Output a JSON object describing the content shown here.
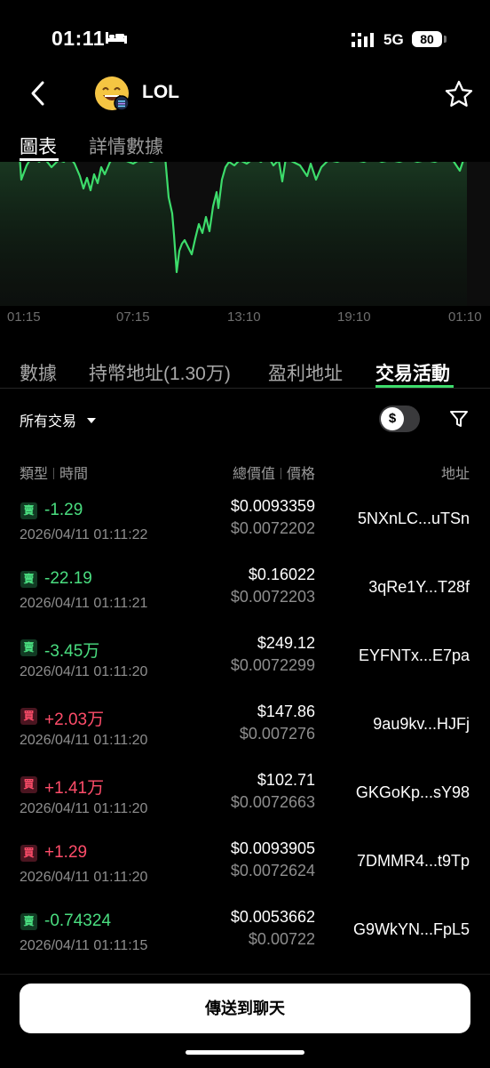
{
  "status_bar": {
    "time": "01:11",
    "network": "5G",
    "battery": "80"
  },
  "header": {
    "token_name": "LOL",
    "icons": [
      "back-chevron-icon",
      "grinning-emoji-avatar",
      "star-icon"
    ]
  },
  "top_tabs": [
    {
      "label": "圖表",
      "active": true
    },
    {
      "label": "詳情數據",
      "active": false
    }
  ],
  "chart": {
    "x_ticks": [
      "01:15",
      "07:15",
      "13:10",
      "19:10",
      "01:10"
    ],
    "line_color": "#3ddc6b"
  },
  "section_tabs": [
    {
      "label": "數據",
      "active": false
    },
    {
      "label": "持幣地址(1.30万)",
      "active": false
    },
    {
      "label": "盈利地址",
      "active": false
    },
    {
      "label": "交易活動",
      "active": true
    }
  ],
  "filter": {
    "label": "所有交易",
    "toggle_symbol": "$"
  },
  "columns": {
    "type": "類型",
    "time": "時間",
    "total": "總價值",
    "price": "價格",
    "address": "地址"
  },
  "trades": [
    {
      "side": "sell",
      "badge": "賣",
      "amount": "-1.29",
      "timestamp": "2026/04/11 01:11:22",
      "total": "$0.0093359",
      "price": "$0.0072202",
      "address": "5NXnLC...uTSn"
    },
    {
      "side": "sell",
      "badge": "賣",
      "amount": "-22.19",
      "timestamp": "2026/04/11 01:11:21",
      "total": "$0.16022",
      "price": "$0.0072203",
      "address": "3qRe1Y...T28f"
    },
    {
      "side": "sell",
      "badge": "賣",
      "amount": "-3.45万",
      "timestamp": "2026/04/11 01:11:20",
      "total": "$249.12",
      "price": "$0.0072299",
      "address": "EYFNTx...E7pa"
    },
    {
      "side": "buy",
      "badge": "買",
      "amount": "+2.03万",
      "timestamp": "2026/04/11 01:11:20",
      "total": "$147.86",
      "price": "$0.007276",
      "address": "9au9kv...HJFj"
    },
    {
      "side": "buy",
      "badge": "買",
      "amount": "+1.41万",
      "timestamp": "2026/04/11 01:11:20",
      "total": "$102.71",
      "price": "$0.0072663",
      "address": "GKGoKp...sY98"
    },
    {
      "side": "buy",
      "badge": "買",
      "amount": "+1.29",
      "timestamp": "2026/04/11 01:11:20",
      "total": "$0.0093905",
      "price": "$0.0072624",
      "address": "7DMMR4...t9Tp"
    },
    {
      "side": "sell",
      "badge": "賣",
      "amount": "-0.74324",
      "timestamp": "2026/04/11 01:11:15",
      "total": "$0.0053662",
      "price": "$0.00722",
      "address": "G9WkYN...FpL5"
    }
  ],
  "bottom": {
    "send_label": "傳送到聊天"
  },
  "colors": {
    "sell": "#4ade80",
    "buy": "#ff4d6a",
    "accent": "#3ddc6b"
  }
}
